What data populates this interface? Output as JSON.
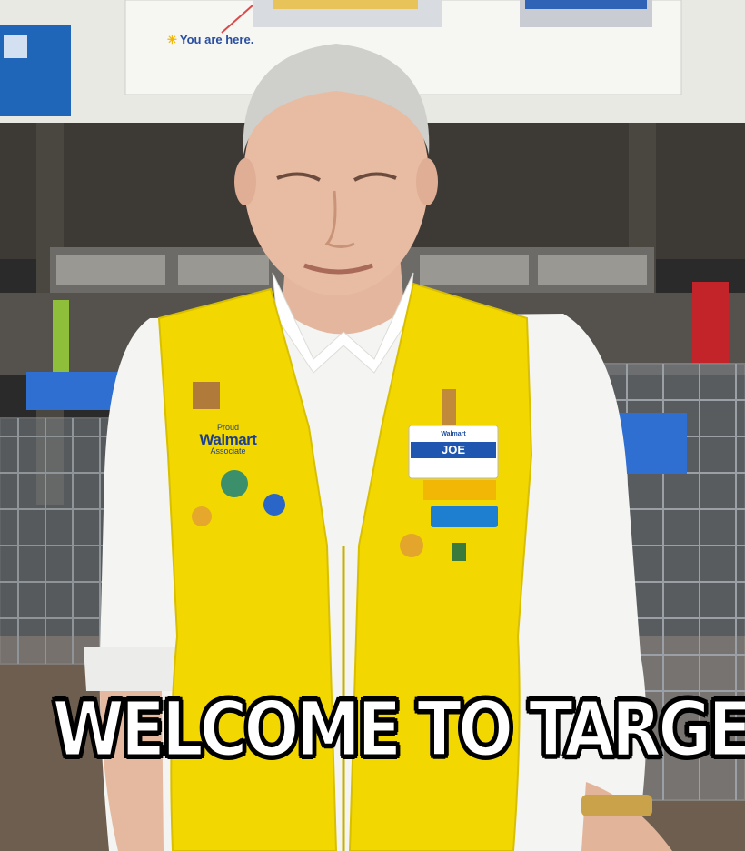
{
  "sign": {
    "you_are_here": "You are here."
  },
  "name_badge": {
    "brand": "Walmart",
    "name": "JOE"
  },
  "vest_pin": {
    "line1": "Proud",
    "line2": "Walmart",
    "line3": "Associate"
  },
  "caption": {
    "text": "WELCOME TO TARGET"
  },
  "colors": {
    "vest": "#f2d800",
    "shirt": "#f4f4f2",
    "badge_blue": "#1e56b0",
    "caption_fill": "#ffffff",
    "caption_stroke": "#000000"
  }
}
